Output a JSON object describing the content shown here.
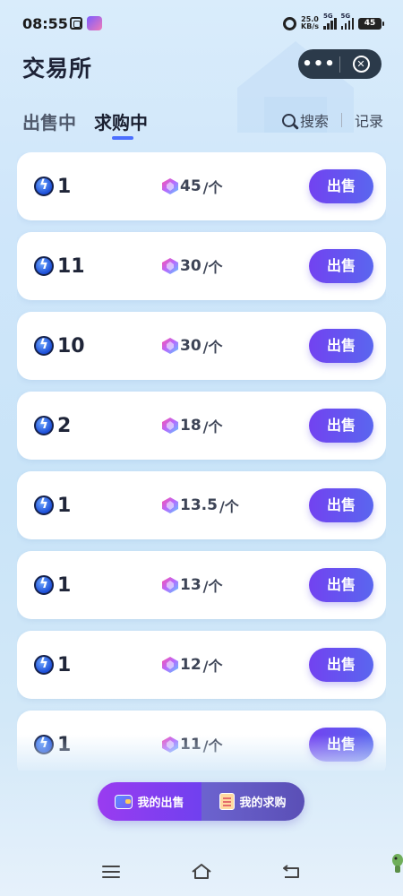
{
  "status_bar": {
    "time": "08:55",
    "net_speed_value": "25.0",
    "net_speed_unit": "KB/s",
    "signal1_label": "5G",
    "signal2_label": "5G",
    "battery": "45"
  },
  "header": {
    "title": "交易所",
    "more_label": "•••",
    "close_label": "✕"
  },
  "tabs": [
    {
      "label": "出售中",
      "active": false
    },
    {
      "label": "求购中",
      "active": true
    }
  ],
  "search_label": "搜索",
  "record_label": "记录",
  "orders": [
    {
      "quantity": "1",
      "price": "45",
      "unit": "/个",
      "button": "出售"
    },
    {
      "quantity": "11",
      "price": "30",
      "unit": "/个",
      "button": "出售"
    },
    {
      "quantity": "10",
      "price": "30",
      "unit": "/个",
      "button": "出售"
    },
    {
      "quantity": "2",
      "price": "18",
      "unit": "/个",
      "button": "出售"
    },
    {
      "quantity": "1",
      "price": "13.5",
      "unit": "/个",
      "button": "出售"
    },
    {
      "quantity": "1",
      "price": "13",
      "unit": "/个",
      "button": "出售"
    },
    {
      "quantity": "1",
      "price": "12",
      "unit": "/个",
      "button": "出售"
    },
    {
      "quantity": "1",
      "price": "11",
      "unit": "/个",
      "button": "出售"
    }
  ],
  "bottom_bar": {
    "my_sales": "我的出售",
    "my_purchases": "我的求购"
  },
  "colors": {
    "accent": "#6b4cf0",
    "tab_indicator": "#4b6fff",
    "capsule": "#2b3a4a"
  },
  "icons": {
    "quantity": "lightning-coin-icon",
    "price": "gem-icon",
    "search": "search-icon",
    "my_sales": "wallet-icon",
    "my_purchases": "notepad-icon"
  }
}
